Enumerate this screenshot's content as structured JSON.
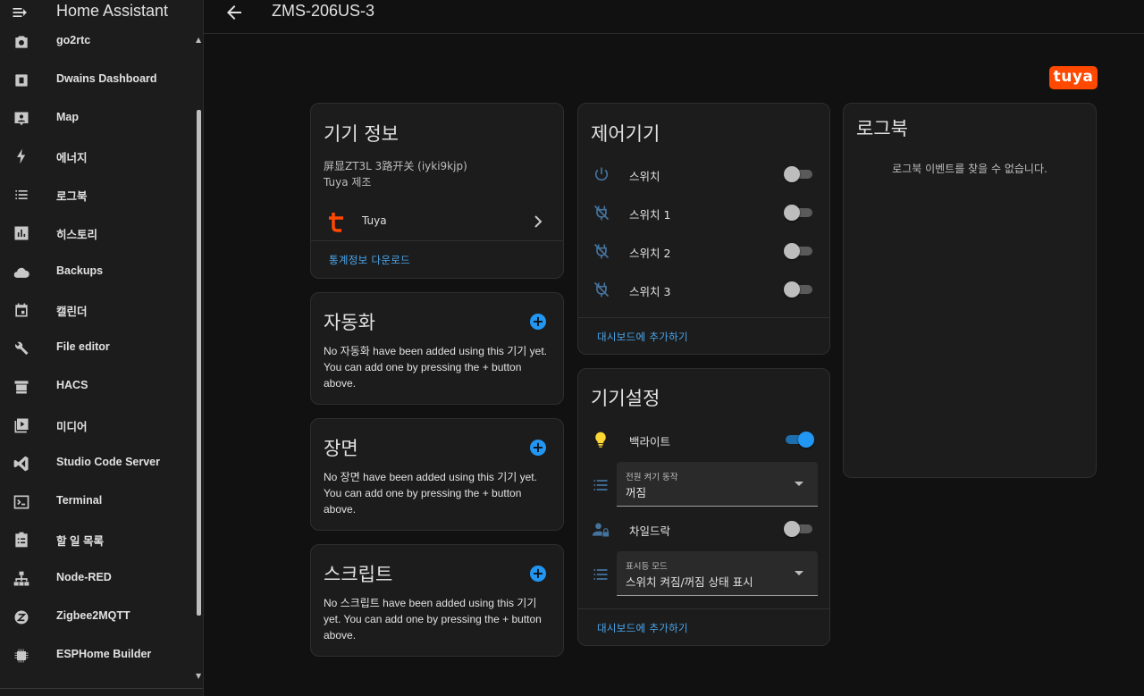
{
  "app": {
    "title": "Home Assistant"
  },
  "sidebar": {
    "items": [
      {
        "label": "go2rtc",
        "icon": "camera-icon"
      },
      {
        "label": "Dwains Dashboard",
        "icon": "dashboard-icon"
      },
      {
        "label": "Map",
        "icon": "map-icon"
      },
      {
        "label": "에너지",
        "icon": "lightning-icon"
      },
      {
        "label": "로그북",
        "icon": "logbook-icon"
      },
      {
        "label": "히스토리",
        "icon": "history-icon"
      },
      {
        "label": "Backups",
        "icon": "cloud-icon"
      },
      {
        "label": "캘린더",
        "icon": "calendar-icon"
      },
      {
        "label": "File editor",
        "icon": "wrench-icon"
      },
      {
        "label": "HACS",
        "icon": "hacs-icon"
      },
      {
        "label": "미디어",
        "icon": "media-icon"
      },
      {
        "label": "Studio Code Server",
        "icon": "vscode-icon"
      },
      {
        "label": "Terminal",
        "icon": "terminal-icon"
      },
      {
        "label": "할 일 목록",
        "icon": "clipboard-icon"
      },
      {
        "label": "Node-RED",
        "icon": "sitemap-icon"
      },
      {
        "label": "Zigbee2MQTT",
        "icon": "zigbee-icon"
      },
      {
        "label": "ESPHome Builder",
        "icon": "chip-icon"
      }
    ]
  },
  "header": {
    "title": "ZMS-206US-3"
  },
  "brand": {
    "logo_text": "tuya",
    "color": "#ff4800"
  },
  "device_info": {
    "title": "기기 정보",
    "model": "屏显ZT3L 3路开关 (iyki9kjp)",
    "manufacturer": "Tuya 제조",
    "integration": "Tuya",
    "download_link": "통계정보 다운로드"
  },
  "automation": {
    "title": "자동화",
    "text": "No 자동화 have been added using this 기기 yet. You can add one by pressing the + button above."
  },
  "scene": {
    "title": "장면",
    "text": "No 장면 have been added using this 기기 yet. You can add one by pressing the + button above."
  },
  "script": {
    "title": "스크립트",
    "text": "No 스크립트 have been added using this 기기 yet. You can add one by pressing the + button above."
  },
  "controls": {
    "title": "제어기기",
    "items": [
      {
        "label": "스위치",
        "on": false
      },
      {
        "label": "스위치 1",
        "on": false
      },
      {
        "label": "스위치 2",
        "on": false
      },
      {
        "label": "스위치 3",
        "on": false
      }
    ],
    "add_to_dashboard": "대시보드에 추가하기"
  },
  "config": {
    "title": "기기설정",
    "backlight": {
      "label": "백라이트",
      "on": true
    },
    "power_on": {
      "label": "전원 켜기 동작",
      "value": "꺼짐"
    },
    "child_lock": {
      "label": "차일드락",
      "on": false
    },
    "indicator": {
      "label": "표시등 모드",
      "value": "스위치 켜짐/꺼짐 상태 표시"
    },
    "add_to_dashboard": "대시보드에 추가하기"
  },
  "logbook": {
    "title": "로그북",
    "empty": "로그북 이벤트를 찾을 수 없습니다."
  },
  "colors": {
    "accent": "#2196f3",
    "link": "#4aa8f0",
    "bulb": "#fdd835"
  }
}
